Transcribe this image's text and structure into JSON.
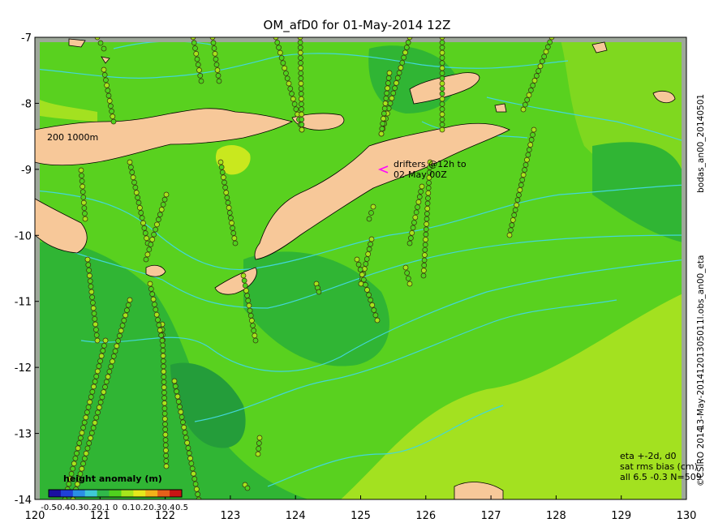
{
  "title": "OM_afD0 for 01-May-2014 12Z",
  "axes": {
    "lon": [
      120,
      121,
      122,
      123,
      124,
      125,
      126,
      127,
      128,
      129,
      130
    ],
    "lat": [
      -7,
      -8,
      -9,
      -10,
      -11,
      -12,
      -13,
      -14
    ],
    "xlim": [
      120,
      130
    ],
    "ylim": [
      -14,
      -7
    ]
  },
  "contour_label": "200  1000m",
  "drifter_note": [
    "drifters @12h to",
    "02-May 00Z"
  ],
  "side_labels": {
    "right_top": "bodas_an00_20140501",
    "right_mid": "1l.obs_an00_eta",
    "right_date": "13-May-2014120130501",
    "right_bottom": "©CSIRO 2014"
  },
  "info_lines": [
    "eta +-2d, d0",
    "sat rms bias (cm)",
    "all 6.5 -0.3 N=509"
  ],
  "colorbar": {
    "title": "height anomaly  (m)",
    "ticks": [
      "-0.5",
      "-0.4",
      "-0.3",
      "-0.2",
      "-0.1",
      "0",
      "0.1",
      "0.2",
      "0.3",
      "0.4",
      "0.5"
    ],
    "colors": [
      "#1a0fa0",
      "#1f40d8",
      "#2a8fe6",
      "#3fcad6",
      "#30b84a",
      "#4fd21e",
      "#a6e51c",
      "#e6e81c",
      "#f2b21a",
      "#e6601a",
      "#c81414"
    ]
  },
  "colors": {
    "sea_base": "#59d11f",
    "sea_dark": "#30b534",
    "sea_light": "#a3e120",
    "land": "#f7c899",
    "shelf": "#9ea89a",
    "contour": "#42d7d9"
  }
}
